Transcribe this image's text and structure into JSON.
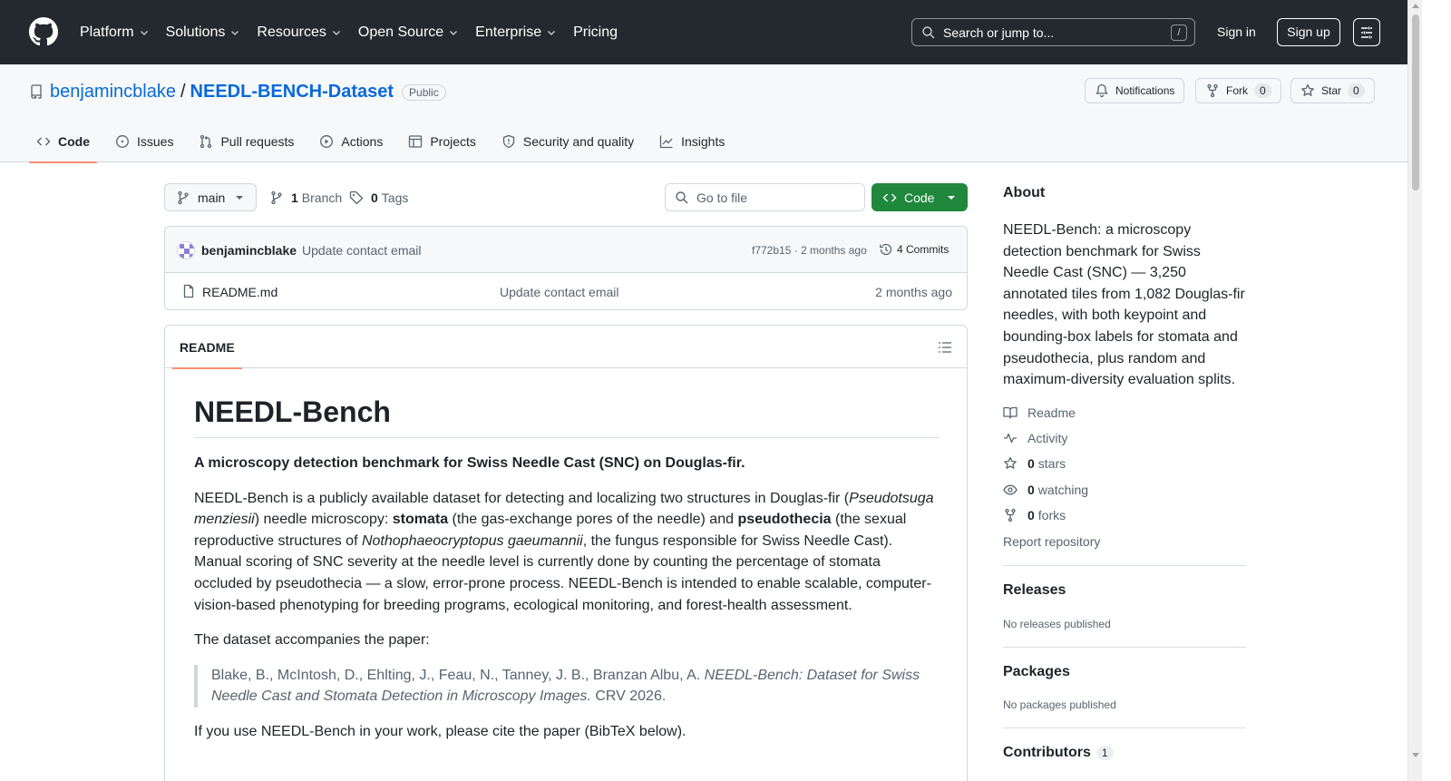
{
  "header": {
    "nav": [
      "Platform",
      "Solutions",
      "Resources",
      "Open Source",
      "Enterprise",
      "Pricing"
    ],
    "search_placeholder": "Search or jump to...",
    "search_shortcut": "/",
    "signin": "Sign in",
    "signup": "Sign up"
  },
  "repo": {
    "owner": "benjamincblake",
    "separator": "/",
    "name": "NEEDL-BENCH-Dataset",
    "visibility": "Public",
    "notifications_label": "Notifications",
    "fork_label": "Fork",
    "fork_count": "0",
    "star_label": "Star",
    "star_count": "0"
  },
  "tabs": [
    {
      "label": "Code",
      "icon": "code-icon"
    },
    {
      "label": "Issues",
      "icon": "issue-icon"
    },
    {
      "label": "Pull requests",
      "icon": "pull-request-icon"
    },
    {
      "label": "Actions",
      "icon": "play-icon"
    },
    {
      "label": "Projects",
      "icon": "table-icon"
    },
    {
      "label": "Security and quality",
      "icon": "shield-icon"
    },
    {
      "label": "Insights",
      "icon": "graph-icon"
    }
  ],
  "branch": {
    "current": "main",
    "branch_count": "1",
    "branch_label": "Branch",
    "tag_count": "0",
    "tag_label": "Tags",
    "goto_placeholder": "Go to file",
    "code_button": "Code"
  },
  "latest_commit": {
    "author": "benjamincblake",
    "message": "Update contact email",
    "hash_and_time": "f772b15 · 2 months ago",
    "commits_label": "4 Commits"
  },
  "files": [
    {
      "name": "README.md",
      "message": "Update contact email",
      "date": "2 months ago"
    }
  ],
  "readme": {
    "tab_label": "README",
    "title": "NEEDL-Bench",
    "lead": "A microscopy detection benchmark for Swiss Needle Cast (SNC) on Douglas-fir.",
    "para1": {
      "t1": "NEEDL-Bench is a publicly available dataset for detecting and localizing two structures in Douglas-fir (",
      "i1": "Pseudotsuga menziesii",
      "t2": ") needle microscopy: ",
      "b1": "stomata",
      "t3": " (the gas-exchange pores of the needle) and ",
      "b2": "pseudothecia",
      "t4": " (the sexual reproductive structures of ",
      "i2": "Nothophaeocryptopus gaeumannii",
      "t5": ", the fungus responsible for Swiss Needle Cast). Manual scoring of SNC severity at the needle level is currently done by counting the percentage of stomata occluded by pseudothecia — a slow, error-prone process. NEEDL-Bench is intended to enable scalable, computer-vision-based phenotyping for breeding programs, ecological monitoring, and forest-health assessment."
    },
    "para2": "The dataset accompanies the paper:",
    "quote": {
      "authors": "Blake, B., McIntosh, D., Ehlting, J., Feau, N., Tanney, J. B., Branzan Albu, A. ",
      "title": "NEEDL-Bench: Dataset for Swiss Needle Cast and Stomata Detection in Microscopy Images.",
      "venue": " CRV 2026."
    },
    "para3": "If you use NEEDL-Bench in your work, please cite the paper (BibTeX below)."
  },
  "sidebar": {
    "about_title": "About",
    "about_desc": "NEEDL-Bench: a microscopy detection benchmark for Swiss Needle Cast (SNC) — 3,250 annotated tiles from 1,082 Douglas-fir needles, with both keypoint and bounding-box labels for stomata and pseudothecia, plus random and maximum-diversity evaluation splits.",
    "readme": "Readme",
    "activity": "Activity",
    "stars_count": "0",
    "stars_label": "stars",
    "watching_count": "0",
    "watching_label": "watching",
    "forks_count": "0",
    "forks_label": "forks",
    "report": "Report repository",
    "releases_title": "Releases",
    "releases_none": "No releases published",
    "packages_title": "Packages",
    "packages_none": "No packages published",
    "contributors_title": "Contributors",
    "contributors_count": "1"
  },
  "colors": {
    "header_bg": "#24292f",
    "link": "#0969da",
    "code_button": "#1f883d",
    "active_tab_underline": "#fd8c73"
  }
}
